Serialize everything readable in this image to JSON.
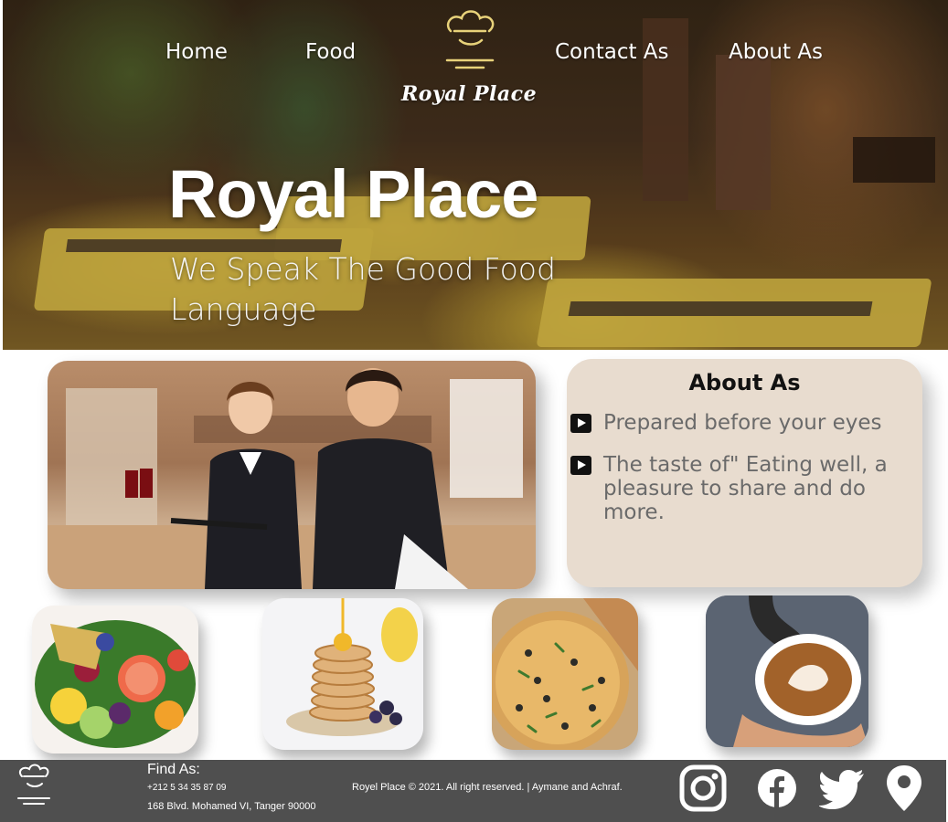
{
  "nav": {
    "home": "Home",
    "food": "Food",
    "contact": "Contact As",
    "about": "About As",
    "brand": "Royal Place"
  },
  "hero": {
    "title": "Royal Place",
    "subtitle": "We Speak The Good Food Language"
  },
  "about": {
    "title": "About As",
    "items": [
      "Prepared before your eyes",
      "The taste of\" Eating well, a pleasure to share and do more."
    ]
  },
  "food_tiles": [
    "fruit-platter",
    "pancakes",
    "pizza",
    "latte"
  ],
  "footer": {
    "find_title": "Find As:",
    "phone": "+212 5 34 35 87 09",
    "address": "168 Blvd. Mohamed VI, Tanger 90000",
    "copyright": "Royel Place  © 2021. All right reserved. | Aymane and Achraf.",
    "social_icons": [
      "instagram-icon",
      "facebook-icon",
      "twitter-icon",
      "location-pin-icon"
    ]
  },
  "colors": {
    "about_card_bg": "#e8dccf",
    "footer_bg": "#4f4f4f",
    "about_text": "#6a6a6a"
  }
}
